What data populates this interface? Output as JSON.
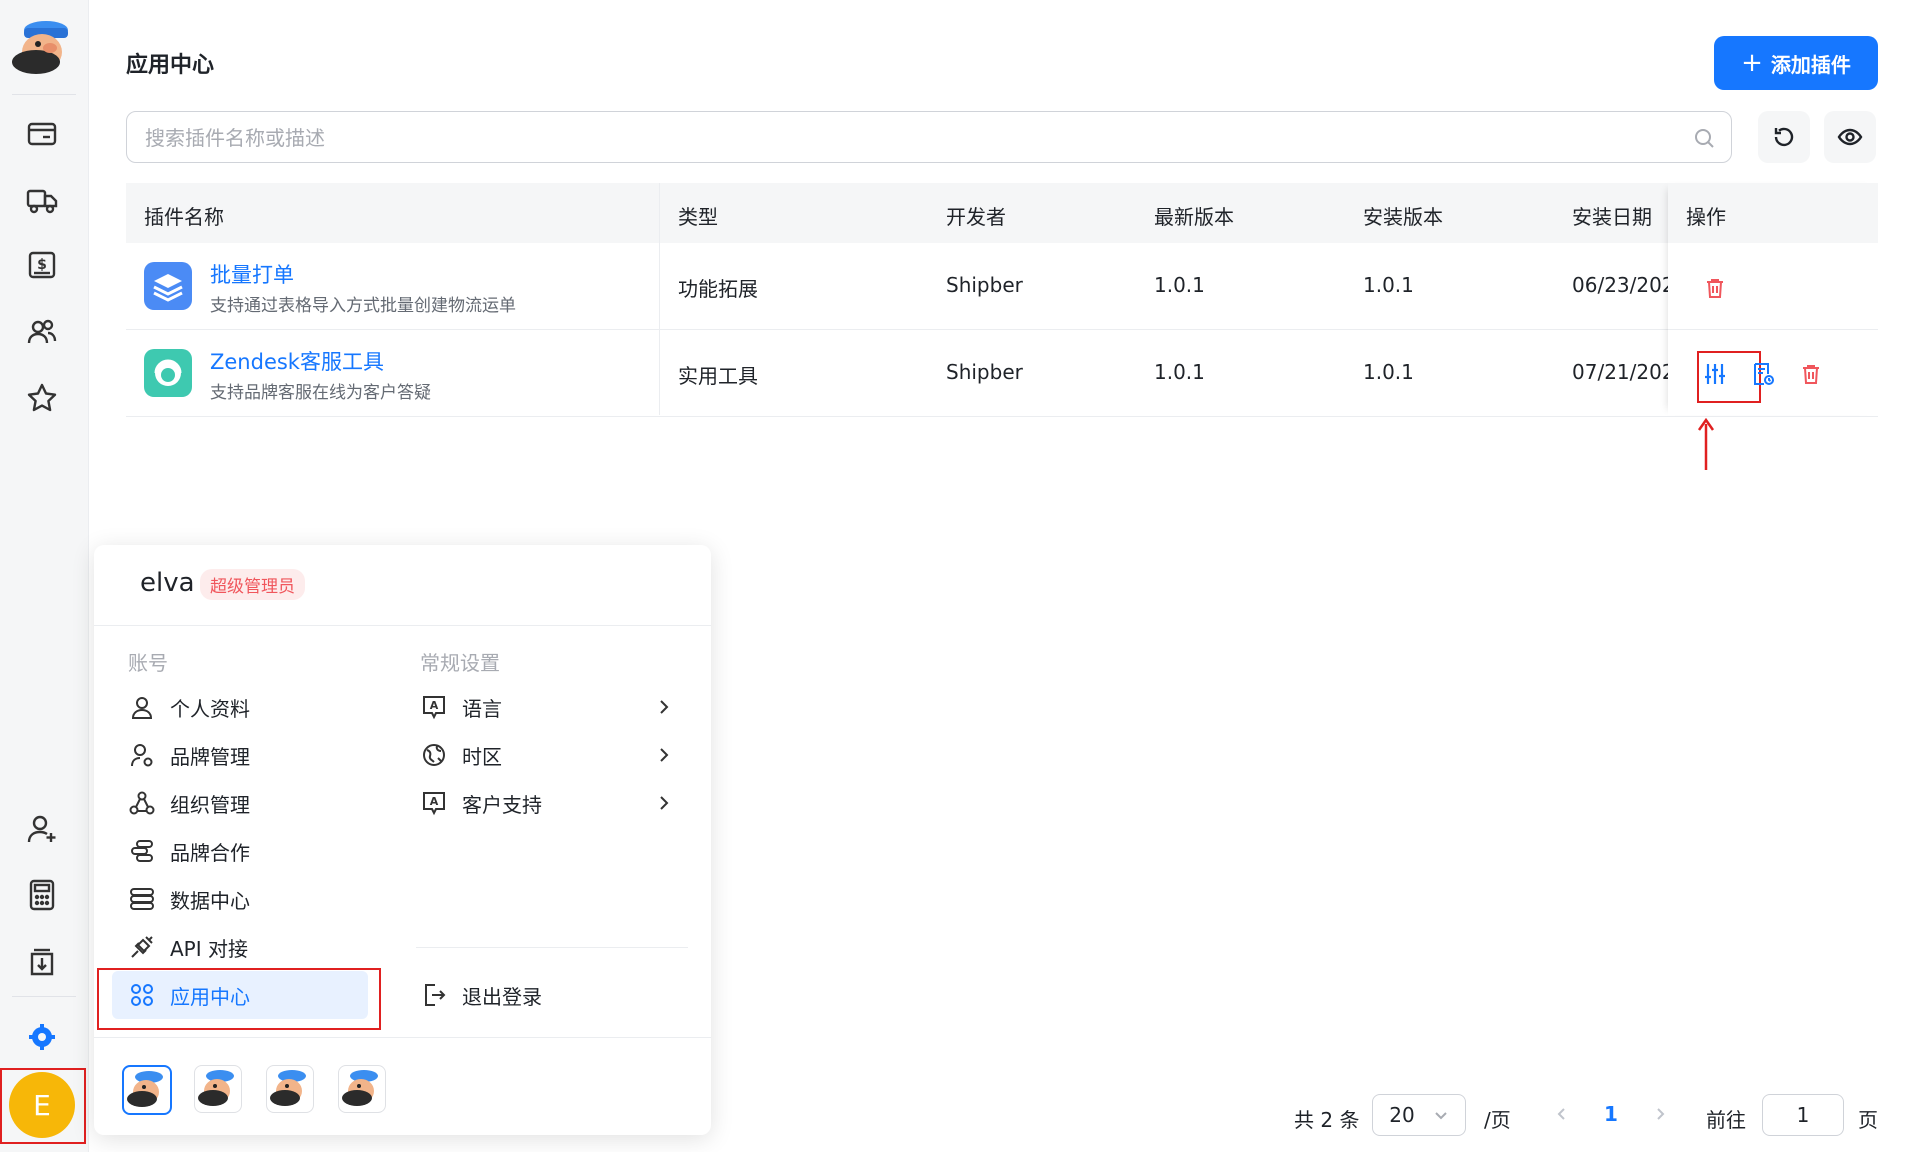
{
  "header": {
    "title": "应用中心",
    "add_button": "添加插件"
  },
  "search": {
    "placeholder": "搜索插件名称或描述",
    "value": ""
  },
  "table": {
    "columns": [
      "插件名称",
      "类型",
      "开发者",
      "最新版本",
      "安装版本",
      "安装日期",
      "操作"
    ],
    "rows": [
      {
        "name": "批量打单",
        "desc": "支持通过表格导入方式批量创建物流运单",
        "type": "功能拓展",
        "developer": "Shipber",
        "latest": "1.0.1",
        "installed": "1.0.1",
        "date": "06/23/202"
      },
      {
        "name": "Zendesk客服工具",
        "desc": "支持品牌客服在线为客户答疑",
        "type": "实用工具",
        "developer": "Shipber",
        "latest": "1.0.1",
        "installed": "1.0.1",
        "date": "07/21/202"
      }
    ]
  },
  "user_menu": {
    "username": "elva",
    "role": "超级管理员",
    "account_section": "账号",
    "general_section": "常规设置",
    "account_items": [
      "个人资料",
      "品牌管理",
      "组织管理",
      "品牌合作",
      "数据中心",
      "API 对接",
      "应用中心"
    ],
    "general_items": [
      "语言",
      "时区",
      "客户支持"
    ],
    "logout": "退出登录"
  },
  "avatar": {
    "initial": "E"
  },
  "pagination": {
    "total": "共 2 条",
    "page_size": "20",
    "per_page": "/页",
    "current": "1",
    "goto_label": "前往",
    "goto_value": "1",
    "page_suffix": "页"
  },
  "colors": {
    "primary": "#1677ff",
    "danger": "#f0565c",
    "highlight": "#e02020",
    "avatar": "#f7b708"
  }
}
